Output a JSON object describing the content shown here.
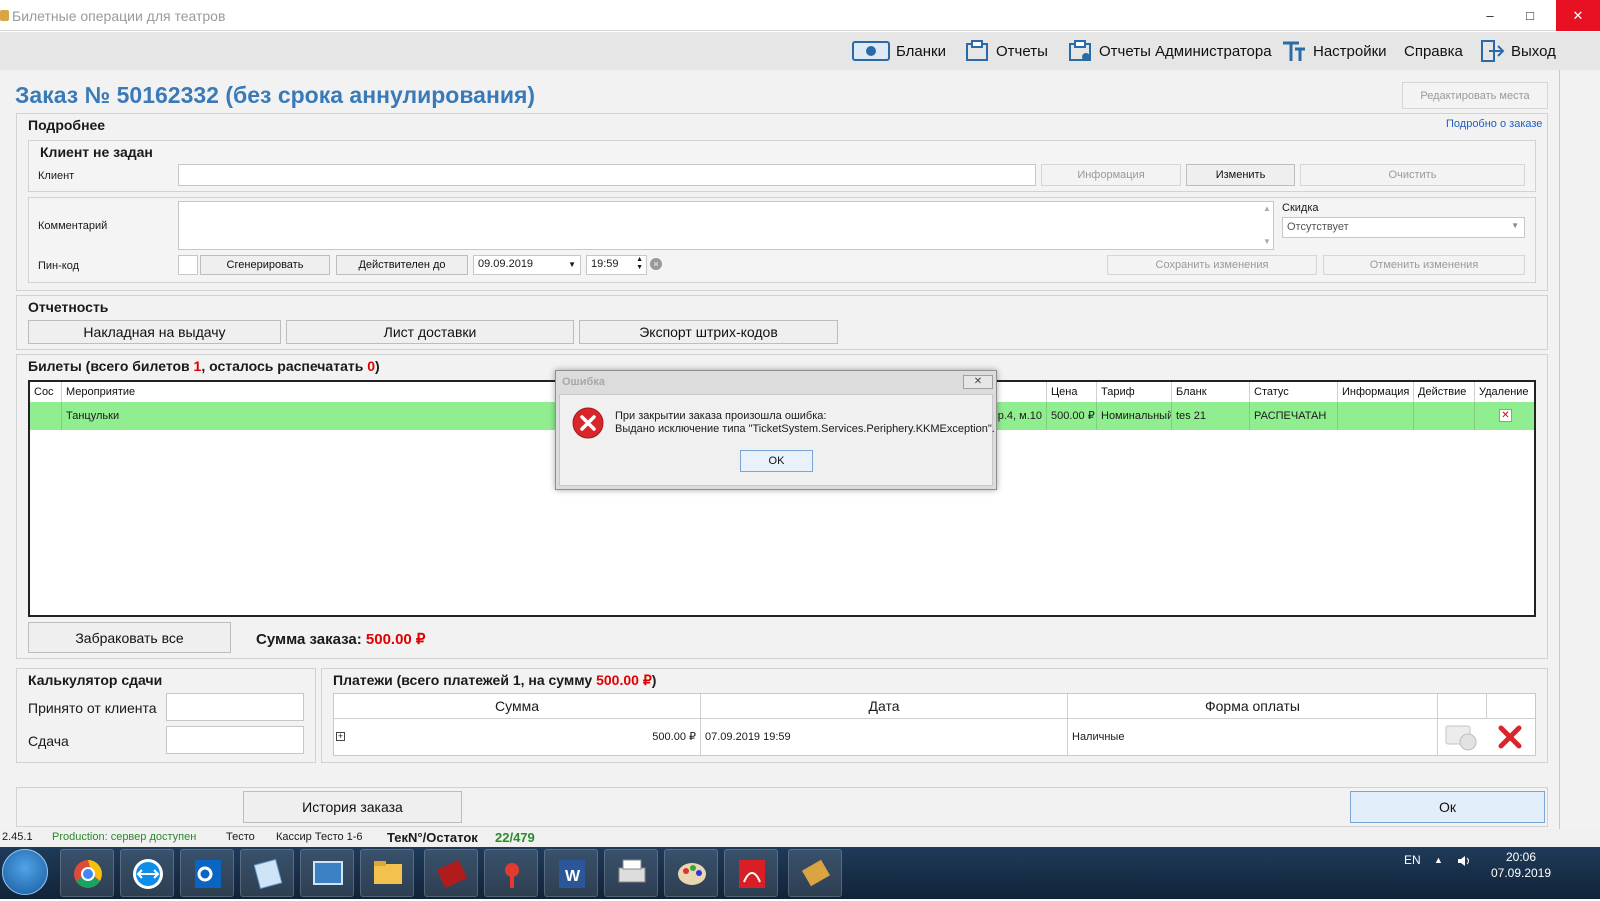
{
  "window": {
    "title": "Билетные операции для театров"
  },
  "toolbar": {
    "blanks": "Бланки",
    "reports": "Отчеты",
    "admin_reports": "Отчеты Администратора",
    "settings": "Настройки",
    "help": "Справка",
    "exit": "Выход"
  },
  "order": {
    "title": "Заказ № 50162332 (без срока аннулирования)",
    "edit_seats": "Редактировать места"
  },
  "details": {
    "title": "Подробнее",
    "details_link": "Подробно о заказе",
    "client_group_title": "Клиент не задан",
    "client_label": "Клиент",
    "client_value": "",
    "info_button": "Информация",
    "change_button": "Изменить",
    "clear_button": "Очистить",
    "comment_label": "Комментарий",
    "comment_value": "",
    "discount_label": "Скидка",
    "discount_value": "Отсутствует",
    "pin_label": "Пин-код",
    "generate_button": "Сгенерировать",
    "valid_until_button": "Действителен до",
    "date_value": "09.09.2019",
    "time_value": "19:59",
    "save_button": "Сохранить изменения",
    "cancel_button": "Отменить изменения"
  },
  "reporting": {
    "title": "Отчетность",
    "invoice_button": "Накладная на выдачу",
    "delivery_button": "Лист доставки",
    "barcodes_button": "Экспорт штрих-кодов"
  },
  "tickets": {
    "title_prefix": "Билеты (всего билетов ",
    "total": "1",
    "title_mid": ", осталось распечатать ",
    "remaining": "0",
    "title_suffix": ")",
    "columns": [
      "Сос",
      "Мероприятие",
      "Цена",
      "Тариф",
      "Бланк",
      "Статус",
      "Информация",
      "Действие",
      "Удаление"
    ],
    "rows": [
      {
        "event": "Танцульки",
        "place": "р.4, м.10",
        "price": "500.00 ₽",
        "tariff": "Номинальный",
        "blank": "tes 21",
        "status": "РАСПЕЧАТАН",
        "info": "",
        "action": ""
      }
    ],
    "reject_all_button": "Забраковать все",
    "sum_label": "Сумма заказа: ",
    "sum_value": "500.00 ₽"
  },
  "calculator": {
    "title": "Калькулятор сдачи",
    "received_label": "Принято от клиента",
    "received_value": "",
    "change_label": "Сдача",
    "change_value": ""
  },
  "payments": {
    "title_prefix": "Платежи (всего платежей 1, на сумму ",
    "title_sum": "500.00 ₽",
    "title_suffix": ")",
    "columns": [
      "Сумма",
      "Дата",
      "Форма оплаты"
    ],
    "rows": [
      {
        "expand": "+",
        "amount": "500.00 ₽",
        "date": "07.09.2019 19:59",
        "method": "Наличные"
      }
    ]
  },
  "footer": {
    "history_button": "История заказа",
    "ok_button": "Ок"
  },
  "statusbar": {
    "version": "2.45.1",
    "server": "Production: сервер доступен",
    "user": "Тесто",
    "cashier": "Кассир Тесто 1-6",
    "blank_label": "ТекN°/Остаток",
    "blank_value": "22/479"
  },
  "dialog": {
    "title": "Ошибка",
    "line1": "При закрытии заказа произошла ошибка:",
    "line2": "Выдано исключение типа \"TicketSystem.Services.Periphery.KKMException\".",
    "ok": "OK"
  },
  "taskbar": {
    "lang": "EN",
    "time": "20:06",
    "date": "07.09.2019"
  },
  "colors": {
    "accent": "#3a7ab8",
    "highlight_row": "#90ee90",
    "sum_red": "#e00000",
    "error_red": "#d9262b"
  }
}
